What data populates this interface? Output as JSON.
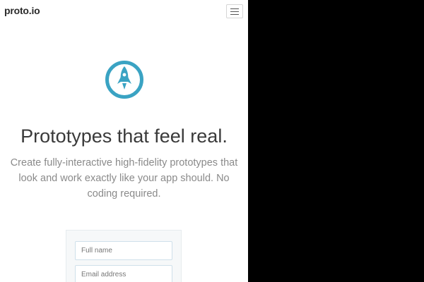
{
  "nav": {
    "logo_text": "proto.io",
    "menu_icon": "hamburger-menu-icon"
  },
  "hero": {
    "icon": "rocket-icon",
    "accent_color": "#3aa3c3",
    "title": "Prototypes that feel real.",
    "subtitle": "Create fully-interactive high-fidelity prototypes that look and work exactly like your app should. No coding required."
  },
  "signup_form": {
    "full_name_placeholder": "Full name",
    "email_placeholder": "Email address"
  }
}
